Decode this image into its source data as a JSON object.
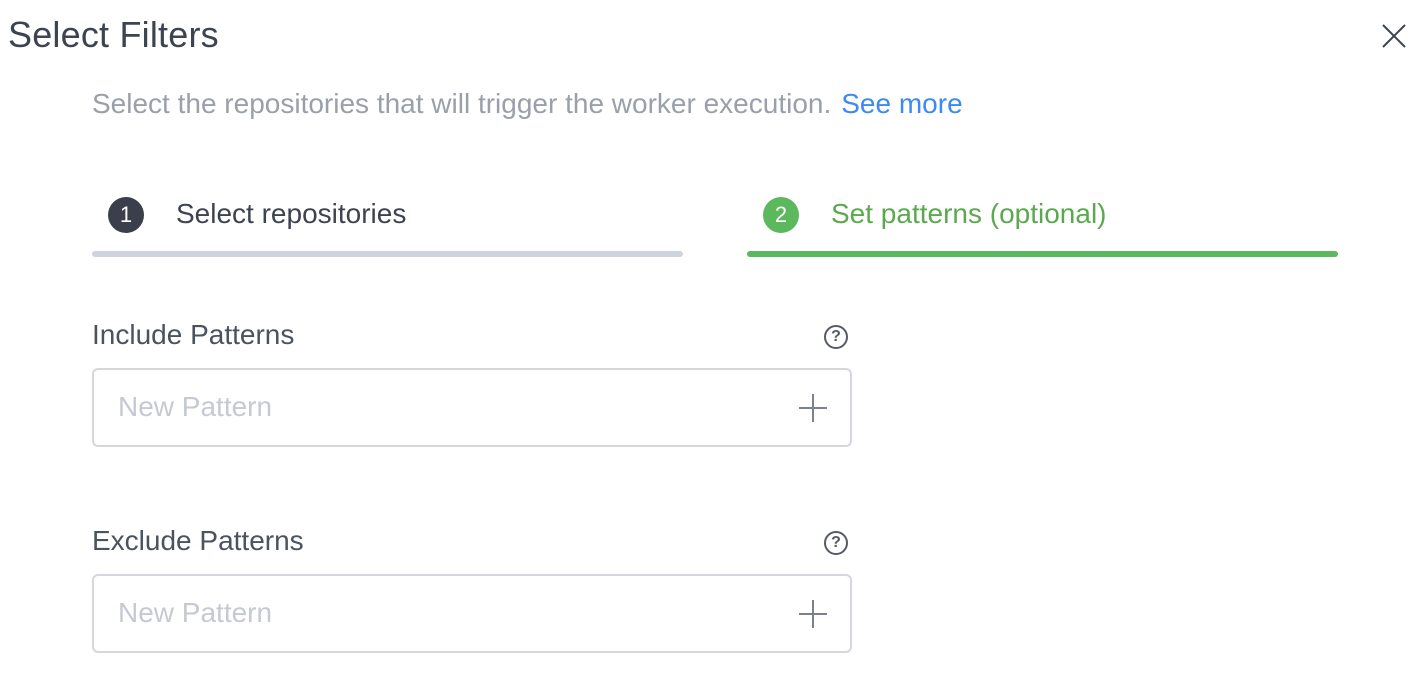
{
  "dialog": {
    "title": "Select Filters",
    "close_icon": "close-icon",
    "subtitle": "Select the repositories that will trigger the worker execution.",
    "see_more": "See more"
  },
  "steps": [
    {
      "number": "1",
      "label": "Select repositories",
      "state": "done"
    },
    {
      "number": "2",
      "label": "Set patterns (optional)",
      "state": "active"
    }
  ],
  "include": {
    "label": "Include Patterns",
    "help_icon": "help-icon",
    "placeholder": "New Pattern",
    "value": "",
    "add_icon": "plus-icon"
  },
  "exclude": {
    "label": "Exclude Patterns",
    "help_icon": "help-icon",
    "placeholder": "New Pattern",
    "value": "",
    "add_icon": "plus-icon"
  },
  "colors": {
    "accent_green": "#5cb85c",
    "link_blue": "#3d8af0",
    "step_inactive_bar": "#cfd3dc",
    "title_text": "#3d4450"
  }
}
